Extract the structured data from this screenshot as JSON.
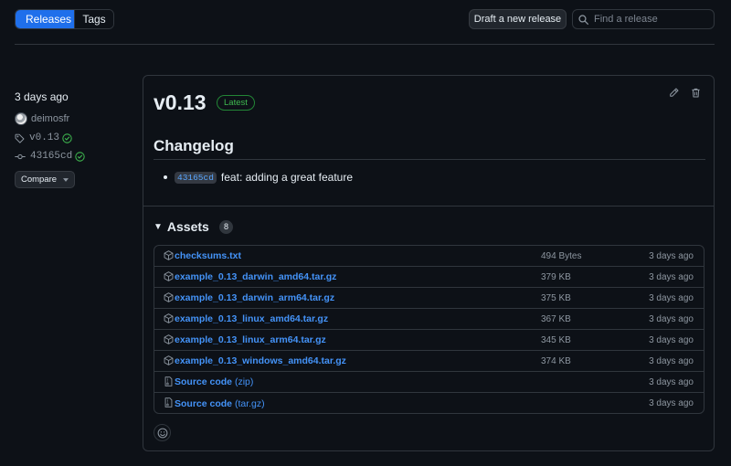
{
  "tabs": {
    "releases_label": "Releases",
    "tags_label": "Tags"
  },
  "actions": {
    "draft_label": "Draft a new release"
  },
  "search": {
    "placeholder": "Find a release",
    "value": ""
  },
  "meta": {
    "time": "3 days ago",
    "author": "deimosfr",
    "tag": "v0.13",
    "commit": "43165cd",
    "compare_label": "Compare"
  },
  "release": {
    "title": "v0.13",
    "badge": "Latest",
    "changelog_heading": "Changelog",
    "changelog_items": [
      {
        "commit": "43165cd",
        "text": "feat: adding a great feature"
      }
    ],
    "assets_label": "Assets",
    "assets_count": "8",
    "assets": [
      {
        "name": "checksums.txt",
        "suffix": "",
        "size": "494 Bytes",
        "date": "3 days ago",
        "icon": "package-icon"
      },
      {
        "name": "example_0.13_darwin_amd64.tar.gz",
        "suffix": "",
        "size": "379 KB",
        "date": "3 days ago",
        "icon": "package-icon"
      },
      {
        "name": "example_0.13_darwin_arm64.tar.gz",
        "suffix": "",
        "size": "375 KB",
        "date": "3 days ago",
        "icon": "package-icon"
      },
      {
        "name": "example_0.13_linux_amd64.tar.gz",
        "suffix": "",
        "size": "367 KB",
        "date": "3 days ago",
        "icon": "package-icon"
      },
      {
        "name": "example_0.13_linux_arm64.tar.gz",
        "suffix": "",
        "size": "345 KB",
        "date": "3 days ago",
        "icon": "package-icon"
      },
      {
        "name": "example_0.13_windows_amd64.tar.gz",
        "suffix": "",
        "size": "374 KB",
        "date": "3 days ago",
        "icon": "package-icon"
      },
      {
        "name": "Source code",
        "suffix": "(zip)",
        "size": "",
        "date": "3 days ago",
        "icon": "file-zip-icon"
      },
      {
        "name": "Source code",
        "suffix": "(tar.gz)",
        "size": "",
        "date": "3 days ago",
        "icon": "file-zip-icon"
      }
    ]
  },
  "colors": {
    "accent": "#1f6feb",
    "link": "#4493f8",
    "success": "#3fb950",
    "background": "#0d1117",
    "border": "#30363d"
  }
}
